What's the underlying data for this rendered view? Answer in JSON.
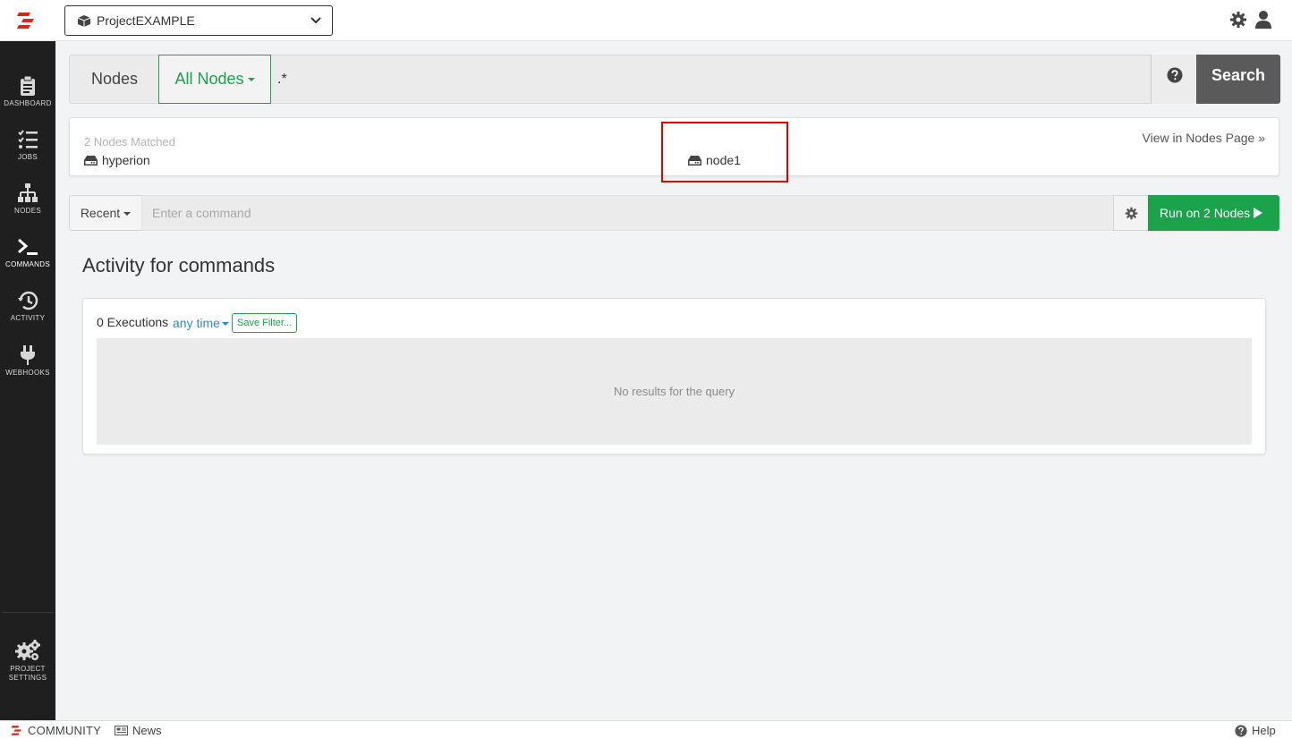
{
  "header": {
    "project_name": "ProjectEXAMPLE",
    "icons": [
      "rundeck-logo-icon",
      "project-box-icon",
      "chevron-down-icon",
      "gear-icon",
      "user-icon"
    ]
  },
  "sidebar": {
    "items": [
      {
        "label": "DASHBOARD",
        "icon": "clipboard-icon",
        "active": false
      },
      {
        "label": "JOBS",
        "icon": "task-list-icon",
        "active": false
      },
      {
        "label": "NODES",
        "icon": "sitemap-icon",
        "active": false
      },
      {
        "label": "COMMANDS",
        "icon": "terminal-icon",
        "active": true
      },
      {
        "label": "ACTIVITY",
        "icon": "history-icon",
        "active": false
      },
      {
        "label": "WEBHOOKS",
        "icon": "plug-icon",
        "active": false
      }
    ],
    "settings": {
      "line1": "PROJECT",
      "line2": "SETTINGS",
      "icon": "gears-icon"
    }
  },
  "node_filter": {
    "nodes_label": "Nodes",
    "all_nodes_label": "All Nodes",
    "filter_value": ".*",
    "search_label": "Search"
  },
  "matches": {
    "count_text": "2 Nodes Matched",
    "nodes": [
      "hyperion",
      "node1"
    ],
    "view_link": "View in Nodes Page »"
  },
  "command": {
    "recent_label": "Recent",
    "placeholder": "Enter a command",
    "run_label": "Run on 2 Nodes"
  },
  "activity": {
    "title": "Activity for commands",
    "exec_count": "0 Executions",
    "time_filter": "any time",
    "save_filter": "Save Filter...",
    "empty_text": "No results for the query"
  },
  "footer": {
    "community": "COMMUNITY",
    "news": "News",
    "help": "Help"
  },
  "colors": {
    "accent_green": "#1aa34a",
    "link_blue": "#2e8bc0",
    "brand_red": "#e2231a",
    "sidebar_bg": "#1f1f1f",
    "highlight_red": "#e00000"
  }
}
